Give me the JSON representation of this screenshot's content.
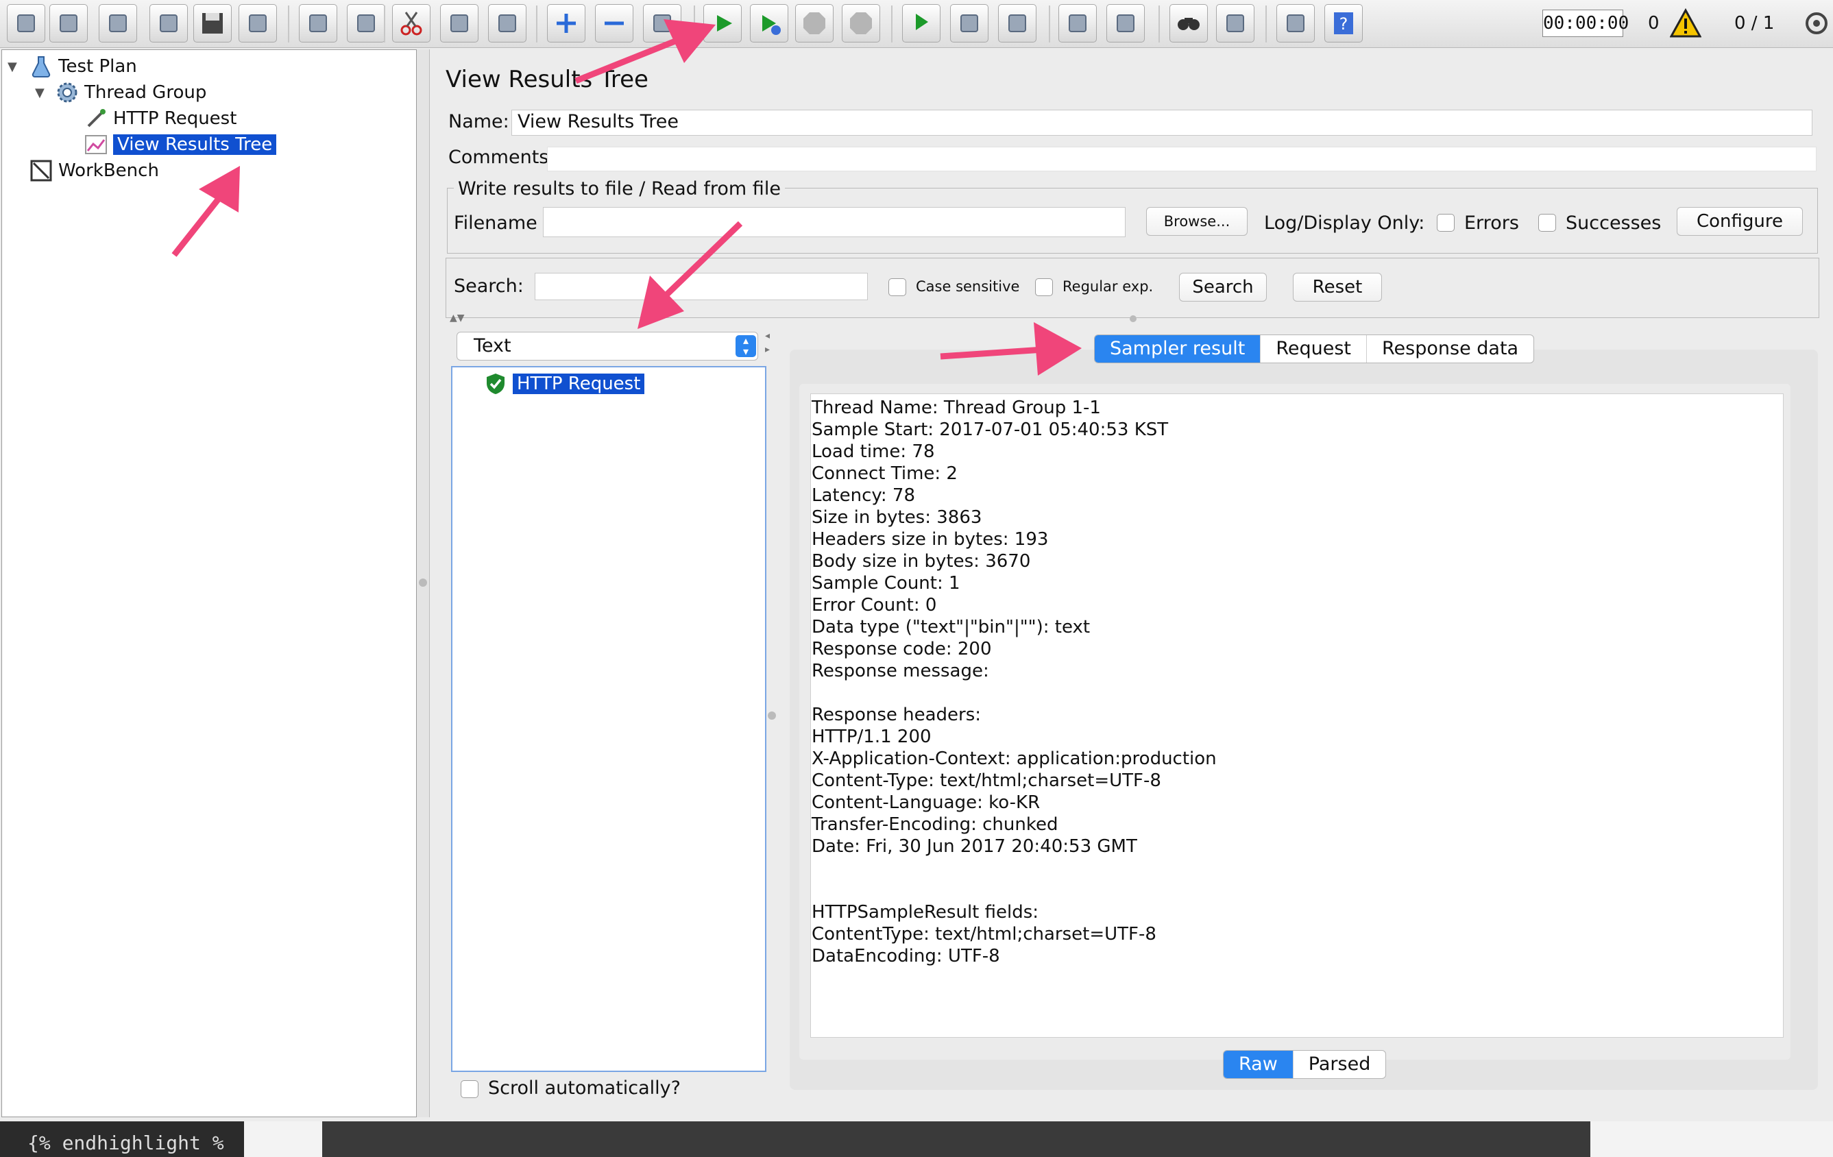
{
  "toolbar": {
    "timer": "00:00:00",
    "error_count": "0",
    "threads": "0 / 1",
    "buttons": [
      {
        "name": "new-icon"
      },
      {
        "name": "templates-icon"
      },
      {
        "name": "open-icon"
      },
      {
        "name": "close-icon"
      },
      {
        "name": "save-icon"
      },
      {
        "name": "save-as-icon"
      },
      {
        "name": "undo-icon"
      },
      {
        "name": "redo-icon"
      },
      {
        "name": "cut-icon"
      },
      {
        "name": "copy-icon"
      },
      {
        "name": "paste-icon"
      },
      {
        "name": "expand-icon"
      },
      {
        "name": "collapse-icon"
      },
      {
        "name": "toggle-icon"
      },
      {
        "name": "start-icon"
      },
      {
        "name": "start-no-pauses-icon"
      },
      {
        "name": "stop-icon"
      },
      {
        "name": "shutdown-icon"
      },
      {
        "name": "remote-start-icon"
      },
      {
        "name": "remote-stop-icon"
      },
      {
        "name": "remote-shutdown-icon"
      },
      {
        "name": "clear-icon"
      },
      {
        "name": "clear-all-icon"
      },
      {
        "name": "search-icon"
      },
      {
        "name": "reset-search-icon"
      },
      {
        "name": "function-helper-icon"
      },
      {
        "name": "help-icon"
      }
    ]
  },
  "tree": {
    "items": [
      {
        "label": "Test Plan"
      },
      {
        "label": "Thread Group"
      },
      {
        "label": "HTTP Request"
      },
      {
        "label": "View Results Tree"
      },
      {
        "label": "WorkBench"
      }
    ]
  },
  "panel": {
    "title": "View Results Tree",
    "name_label": "Name:",
    "name_value": "View Results Tree",
    "comments_label": "Comments:",
    "file_group_title": "Write results to file / Read from file",
    "filename_label": "Filename",
    "browse_label": "Browse...",
    "log_display_label": "Log/Display Only:",
    "errors_label": "Errors",
    "successes_label": "Successes",
    "configure_label": "Configure",
    "search_label": "Search:",
    "case_sensitive_label": "Case sensitive",
    "regular_exp_label": "Regular exp.",
    "search_button": "Search",
    "reset_button": "Reset",
    "renderer_value": "Text",
    "result_item": "HTTP Request",
    "scroll_label": "Scroll automatically?",
    "tabs": [
      "Sampler result",
      "Request",
      "Response data"
    ],
    "view_modes": [
      "Raw",
      "Parsed"
    ]
  },
  "sampler_result_lines": [
    "Thread Name: Thread Group 1-1",
    "Sample Start: 2017-07-01 05:40:53 KST",
    "Load time: 78",
    "Connect Time: 2",
    "Latency: 78",
    "Size in bytes: 3863",
    "Headers size in bytes: 193",
    "Body size in bytes: 3670",
    "Sample Count: 1",
    "Error Count: 0",
    "Data type (\"text\"|\"bin\"|\"\"): text",
    "Response code: 200",
    "Response message: ",
    "",
    "Response headers:",
    "HTTP/1.1 200",
    "X-Application-Context: application:production",
    "Content-Type: text/html;charset=UTF-8",
    "Content-Language: ko-KR",
    "Transfer-Encoding: chunked",
    "Date: Fri, 30 Jun 2017 20:40:53 GMT",
    "",
    "",
    "HTTPSampleResult fields:",
    "ContentType: text/html;charset=UTF-8",
    "DataEncoding: UTF-8"
  ],
  "background": {
    "code_snippet": "{% endhighlight %"
  },
  "colors": {
    "selection": "#1050d0",
    "accent": "#2a85f0",
    "annotation_arrow": "#f0457a"
  }
}
